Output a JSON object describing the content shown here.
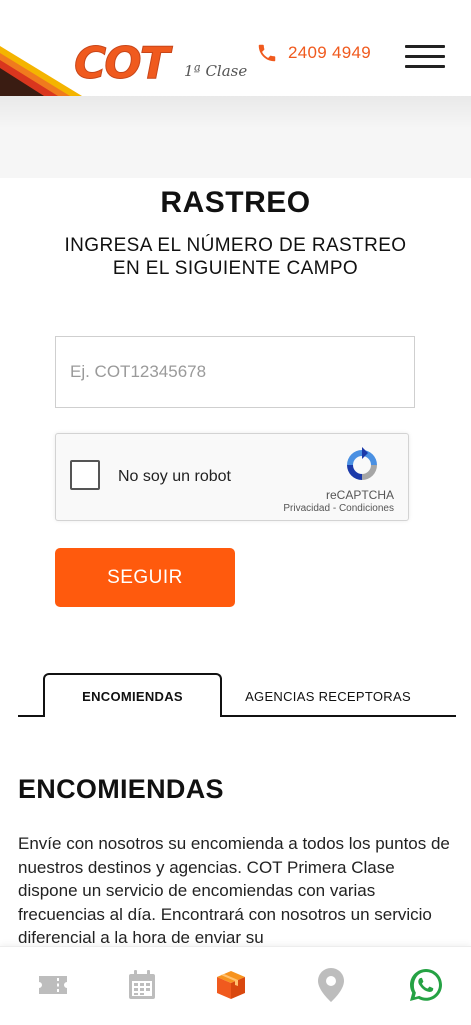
{
  "header": {
    "logo_text": "COT",
    "logo_suffix": "1ª Clase",
    "phone": "2409 4949"
  },
  "page": {
    "title": "RASTREO",
    "subtitle_line1": "INGRESA EL NÚMERO DE RASTREO",
    "subtitle_line2": "EN EL SIGUIENTE CAMPO"
  },
  "tracking": {
    "placeholder": "Ej. COT12345678",
    "value": ""
  },
  "captcha": {
    "label": "No soy un robot",
    "brand": "reCAPTCHA",
    "privacy": "Privacidad",
    "separator": " - ",
    "terms": "Condiciones"
  },
  "submit_label": "SEGUIR",
  "tabs": [
    {
      "label": "ENCOMIENDAS",
      "active": true
    },
    {
      "label": "AGENCIAS RECEPTORAS",
      "active": false
    }
  ],
  "section": {
    "title": "ENCOMIENDAS",
    "text": "Envíe con nosotros su encomienda a todos los puntos de nuestros destinos y agencias. COT Primera Clase dispone un servicio de encomiendas con varias frecuencias al día. Encontrará con nosotros un servicio diferencial a la hora de enviar su"
  },
  "bottom_nav": {
    "icons": [
      "ticket-icon",
      "calendar-icon",
      "package-icon",
      "location-pin-icon",
      "whatsapp-icon"
    ],
    "active": "package-icon"
  },
  "colors": {
    "brand_orange": "#f05a1e",
    "button_orange": "#ff5a0d",
    "nav_gray": "#bdbdbd",
    "whatsapp_green": "#25a244"
  }
}
